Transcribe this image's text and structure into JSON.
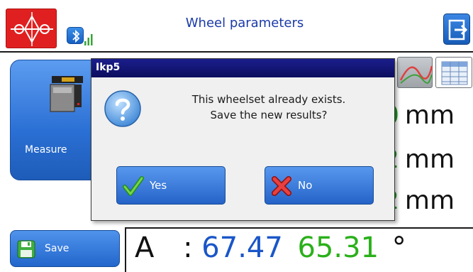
{
  "header": {
    "title": "Wheel parameters",
    "logo_icon": "wheelset-logo-icon",
    "bluetooth_icon": "bluetooth-icon",
    "signal_icon": "signal-bars-icon",
    "exit_icon": "exit-icon"
  },
  "main": {
    "measure_label": "Measure",
    "rows": [
      {
        "digit": "0",
        "unit": "mm"
      },
      {
        "digit": "2",
        "unit": "mm"
      },
      {
        "digit": "2",
        "unit": "mm"
      }
    ],
    "angle": {
      "label": "A",
      "separator": ":",
      "value1": "67.47",
      "value2": "65.31",
      "unit": "°"
    },
    "save_label": "Save"
  },
  "dialog": {
    "title": "Ikp5",
    "message_line1": "This wheelset already exists.",
    "message_line2": "Save the new results?",
    "yes_label": "Yes",
    "no_label": "No"
  },
  "colors": {
    "accent_blue": "#2a6fd4",
    "dialog_title_bg": "#0c0e5e",
    "green_value": "#2ab01a",
    "blue_value": "#1a56c8",
    "logo_red": "#e02020"
  }
}
